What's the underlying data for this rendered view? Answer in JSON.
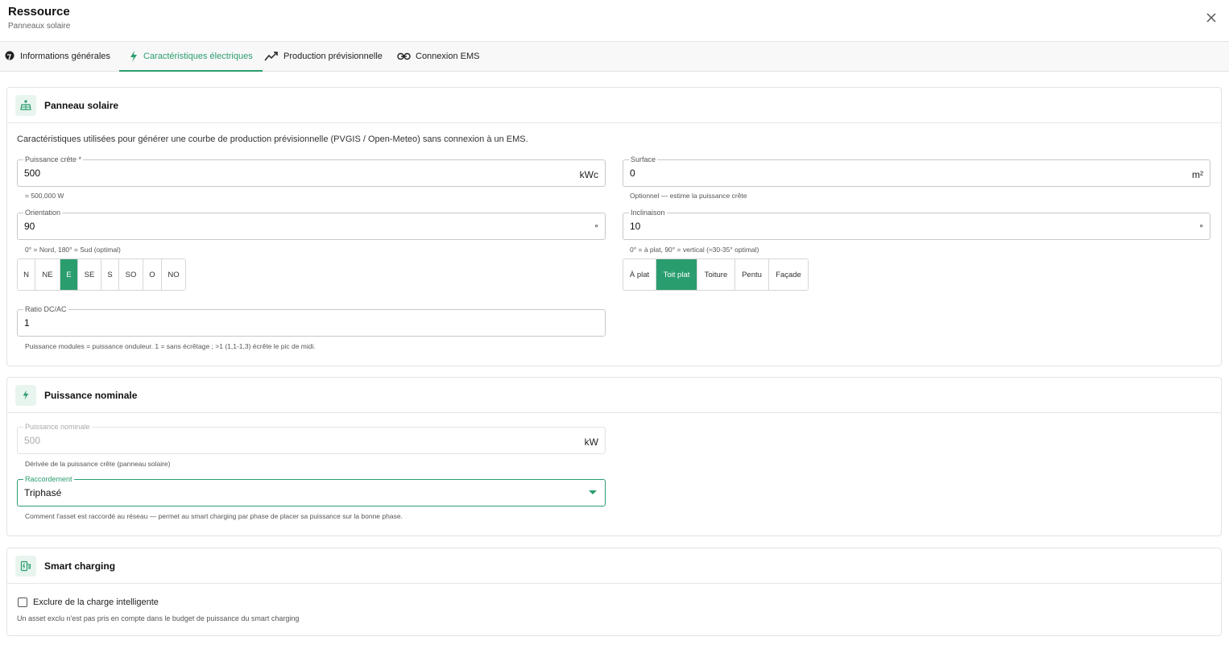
{
  "header": {
    "title": "Ressource",
    "subtitle": "Panneaux solaire"
  },
  "tabs": [
    {
      "label": "Informations générales",
      "icon": "location-pin-icon",
      "active": false
    },
    {
      "label": "Caractéristiques électriques",
      "icon": "lightning-icon",
      "active": true
    },
    {
      "label": "Production prévisionnelle",
      "icon": "trend-chart-icon",
      "active": false
    },
    {
      "label": "Connexion EMS",
      "icon": "link-icon",
      "active": false
    }
  ],
  "solar_panel": {
    "title": "Panneau solaire",
    "description": "Caractéristiques utilisées pour générer une courbe de production prévisionnelle (PVGIS / Open-Meteo) sans connexion à un EMS.",
    "peak_power": {
      "label": "Puissance crête *",
      "value": "500",
      "unit": "kWc",
      "helper": "= 500,000 W"
    },
    "surface": {
      "label": "Surface",
      "value": "0",
      "unit": "m²",
      "helper": "Optionnel — estime la puissance crête"
    },
    "orientation": {
      "label": "Orientation",
      "value": "90",
      "unit": "°",
      "helper": "0° = Nord, 180° = Sud (optimal)"
    },
    "inclination": {
      "label": "Inclinaison",
      "value": "10",
      "unit": "°",
      "helper": "0° = à plat, 90° = vertical (≈30-35° optimal)"
    },
    "orientation_options": [
      "N",
      "NE",
      "E",
      "SE",
      "S",
      "SO",
      "O",
      "NO"
    ],
    "orientation_selected": "E",
    "inclination_options": [
      "À plat",
      "Toit plat",
      "Toiture",
      "Pentu",
      "Façade"
    ],
    "inclination_selected": "Toit plat",
    "dc_ac_ratio": {
      "label": "Ratio DC/AC",
      "value": "1",
      "helper": "Puissance modules = puissance onduleur. 1 = sans écrêtage ; >1 (1,1-1,3) écrête le pic de midi."
    }
  },
  "nominal_power": {
    "title": "Puissance nominale",
    "nominal": {
      "label": "Puissance nominale",
      "value": "500",
      "unit": "kW",
      "helper": "Dérivée de la puissance crête (panneau solaire)"
    },
    "connection": {
      "label": "Raccordement",
      "value": "Triphasé",
      "helper": "Comment l'asset est raccordé au réseau — permet au smart charging par phase de placer sa puissance sur la bonne phase."
    }
  },
  "smart_charging": {
    "title": "Smart charging",
    "exclude_label": "Exclure de la charge intelligente",
    "exclude_checked": false,
    "helper": "Un asset exclu n'est pas pris en compte dans le budget de puissance du smart charging"
  },
  "colors": {
    "accent": "#2a9d6e",
    "accent_light": "#e8f5ee"
  }
}
